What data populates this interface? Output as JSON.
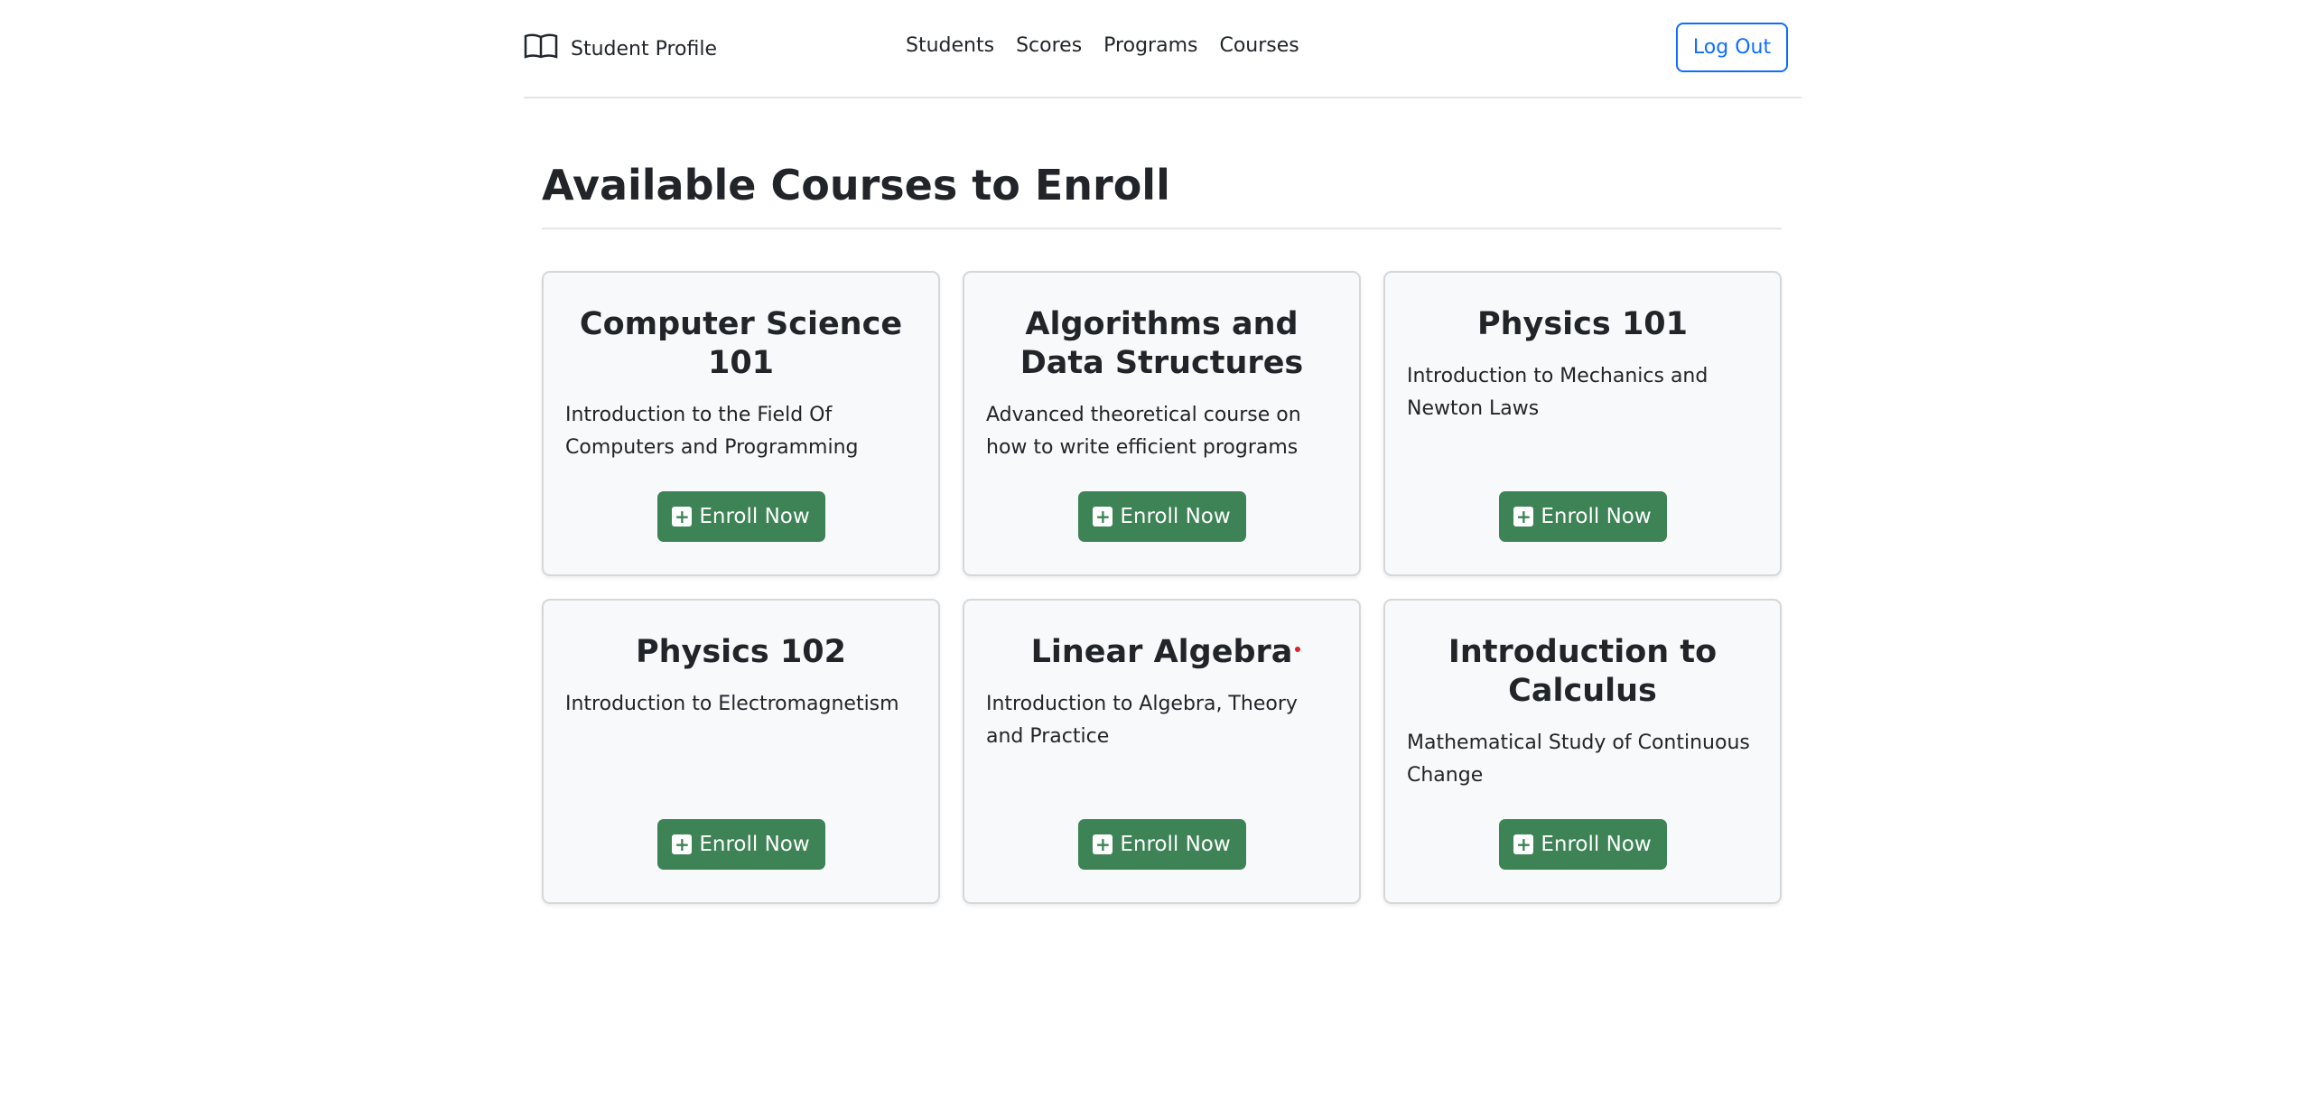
{
  "nav": {
    "brand": "Student Profile",
    "brand_icon": "book-icon",
    "links": [
      "Students",
      "Scores",
      "Programs",
      "Courses"
    ],
    "logout": "Log Out"
  },
  "page": {
    "title": "Available Courses to Enroll"
  },
  "courses": [
    {
      "title": "Computer Science 101",
      "description": "Introduction to the Field Of Computers and Programming",
      "button": "Enroll Now"
    },
    {
      "title": "Algorithms and Data Structures",
      "description": "Advanced theoretical course on how to write efficient programs",
      "button": "Enroll Now"
    },
    {
      "title": "Physics 101",
      "description": "Introduction to Mechanics and Newton Laws",
      "button": "Enroll Now"
    },
    {
      "title": "Physics 102",
      "description": "Introduction to Electromagnetism",
      "button": "Enroll Now"
    },
    {
      "title": "Linear Algebra",
      "description": "Introduction to Algebra, Theory and Practice",
      "button": "Enroll Now"
    },
    {
      "title": "Introduction to Calculus",
      "description": "Mathematical Study of Continuous Change",
      "button": "Enroll Now"
    }
  ],
  "colors": {
    "primary": "#0d6efd",
    "success": "#3d8356",
    "card_bg": "#f8f9fa"
  }
}
